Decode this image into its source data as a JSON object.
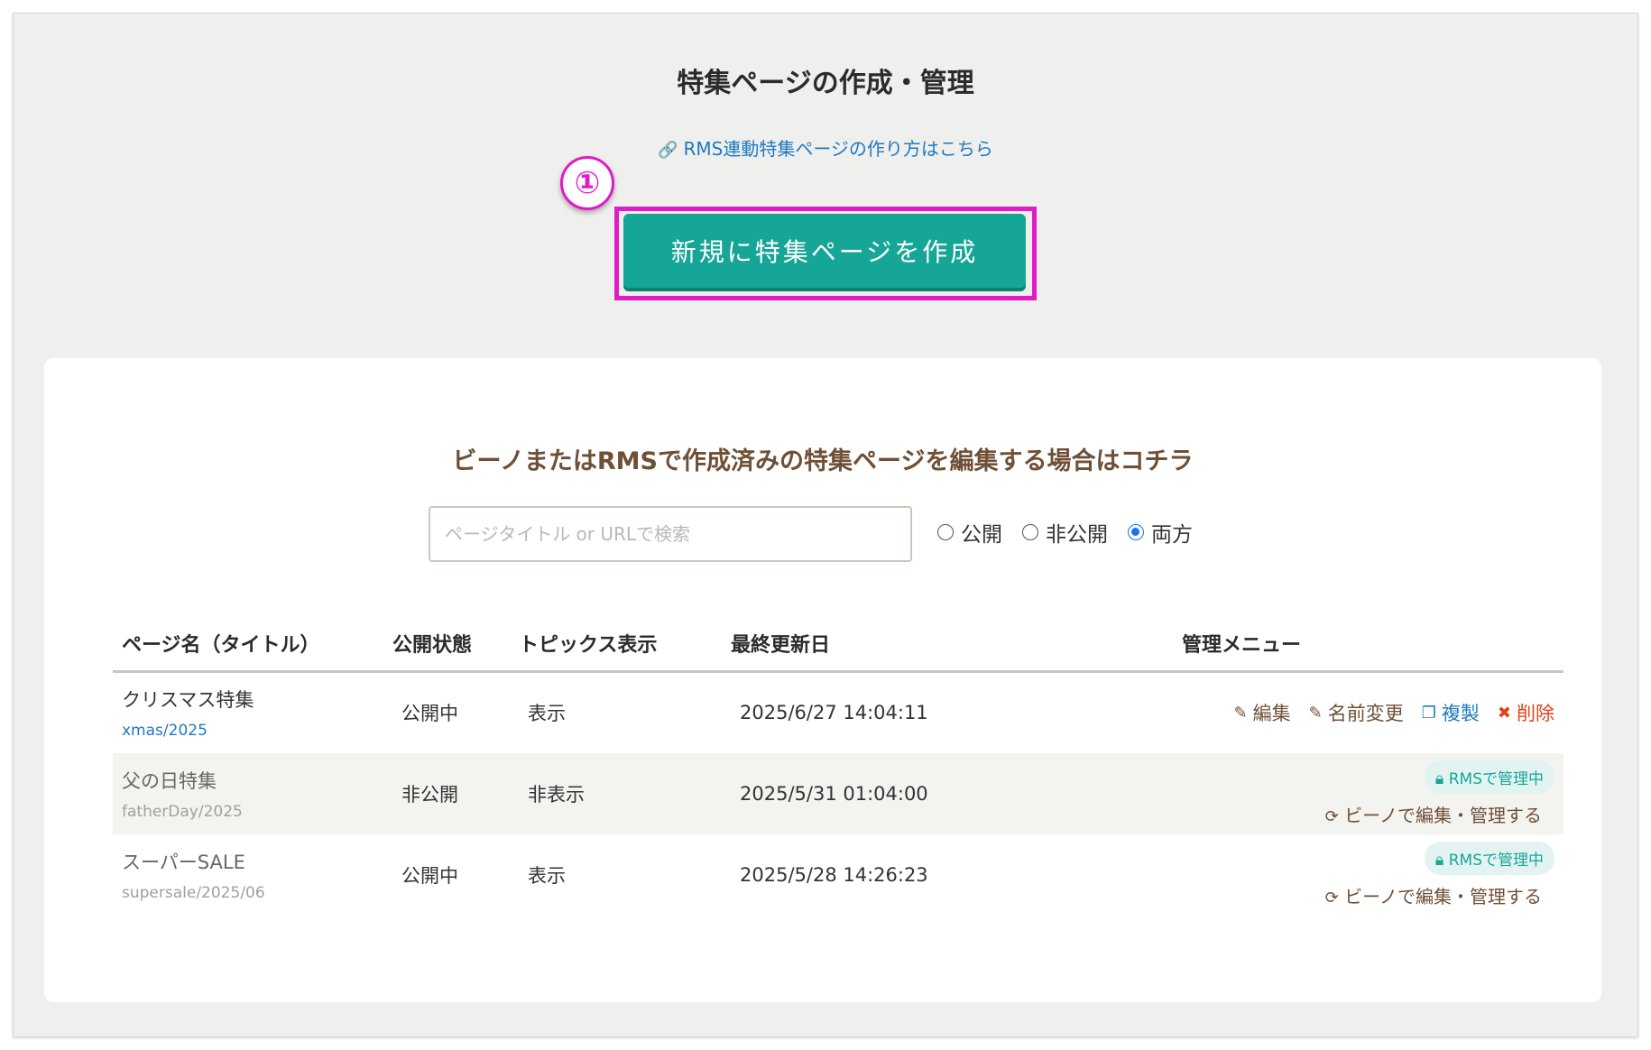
{
  "header": {
    "title": "特集ページの作成・管理",
    "help_link": "RMS連動特集ページの作り方はこちら",
    "step_marker": "①",
    "create_button": "新規に特集ページを作成"
  },
  "edit_section": {
    "heading": "ビーノまたはRMSで作成済みの特集ページを編集する場合はコチラ",
    "search_placeholder": "ページタイトル or URLで検索",
    "filters": [
      {
        "label": "公開",
        "selected": false
      },
      {
        "label": "非公開",
        "selected": false
      },
      {
        "label": "両方",
        "selected": true
      }
    ]
  },
  "table": {
    "columns": [
      "ページ名（タイトル）",
      "公開状態",
      "トピックス表示",
      "最終更新日",
      "管理メニュー"
    ],
    "rows": [
      {
        "name": "クリスマス特集",
        "slug": "xmas/2025",
        "status": "公開中",
        "topics": "表示",
        "updated": "2025/6/27 14:04:11"
      },
      {
        "name": "父の日特集",
        "slug": "fatherDay/2025",
        "status": "非公開",
        "topics": "非表示",
        "updated": "2025/5/31 01:04:00"
      },
      {
        "name": "スーパーSALE",
        "slug": "supersale/2025/06",
        "status": "公開中",
        "topics": "表示",
        "updated": "2025/5/28 14:26:23"
      }
    ],
    "actions": {
      "edit": "編集",
      "rename": "名前変更",
      "duplicate": "複製",
      "delete": "削除",
      "rms_badge": "RMSで管理中",
      "manage_link": "ビーノで編集・管理する"
    }
  },
  "colors": {
    "accent": "#16a697",
    "highlight": "#e21bc8",
    "link": "#1f7ac0",
    "brown": "#6f5036",
    "danger": "#e0431c"
  }
}
